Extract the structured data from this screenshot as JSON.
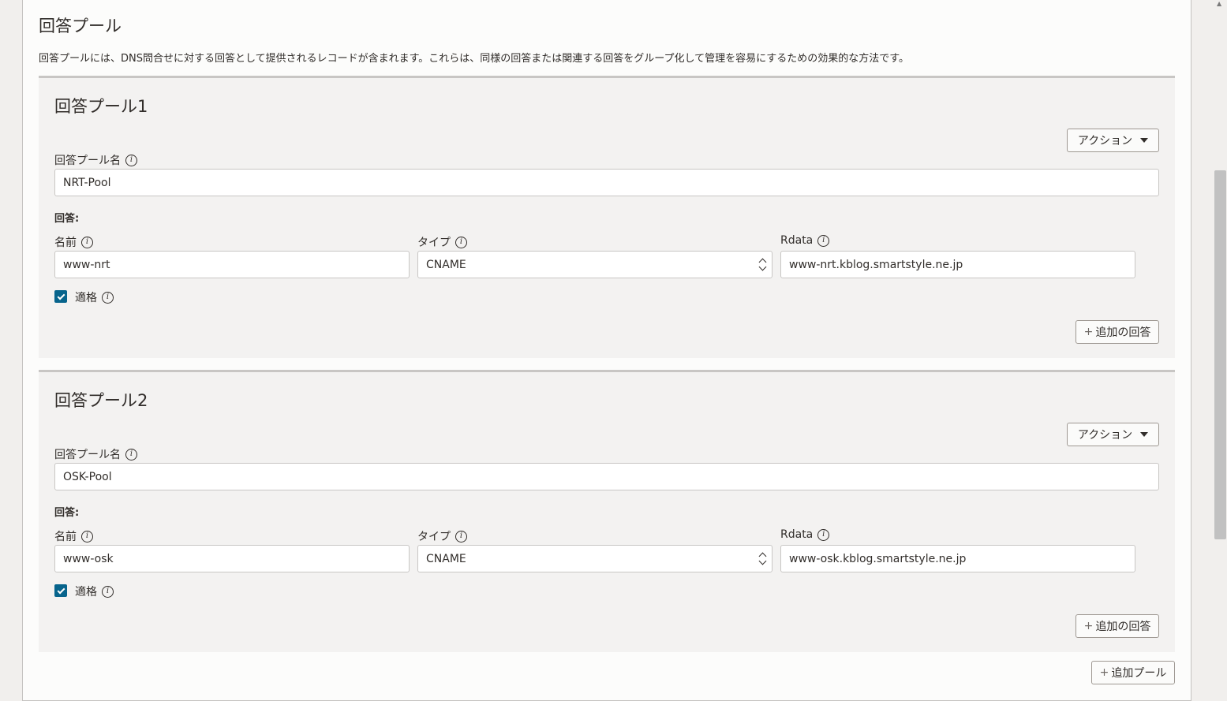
{
  "section": {
    "title": "回答プール",
    "description": "回答プールには、DNS問合せに対する回答として提供されるレコードが含まれます。これらは、同様の回答または関連する回答をグループ化して管理を容易にするための効果的な方法です。"
  },
  "pools": [
    {
      "title": "回答プール1",
      "action_label": "アクション",
      "name_label": "回答プール名",
      "name_value": "NRT-Pool",
      "answers_label": "回答:",
      "col_name_label": "名前",
      "col_type_label": "タイプ",
      "col_rdata_label": "Rdata",
      "answer_name": "www-nrt",
      "answer_type": "CNAME",
      "answer_rdata": "www-nrt.kblog.smartstyle.ne.jp",
      "eligible_label": "適格",
      "eligible_checked": true,
      "add_answer_label": "追加の回答"
    },
    {
      "title": "回答プール2",
      "action_label": "アクション",
      "name_label": "回答プール名",
      "name_value": "OSK-Pool",
      "answers_label": "回答:",
      "col_name_label": "名前",
      "col_type_label": "タイプ",
      "col_rdata_label": "Rdata",
      "answer_name": "www-osk",
      "answer_type": "CNAME",
      "answer_rdata": "www-osk.kblog.smartstyle.ne.jp",
      "eligible_label": "適格",
      "eligible_checked": true,
      "add_answer_label": "追加の回答"
    }
  ],
  "add_pool_label": "追加プール",
  "colors": {
    "accent": "#07648c",
    "panel_bg": "#fcfcfb",
    "pool_bg": "#f3f2f1"
  }
}
